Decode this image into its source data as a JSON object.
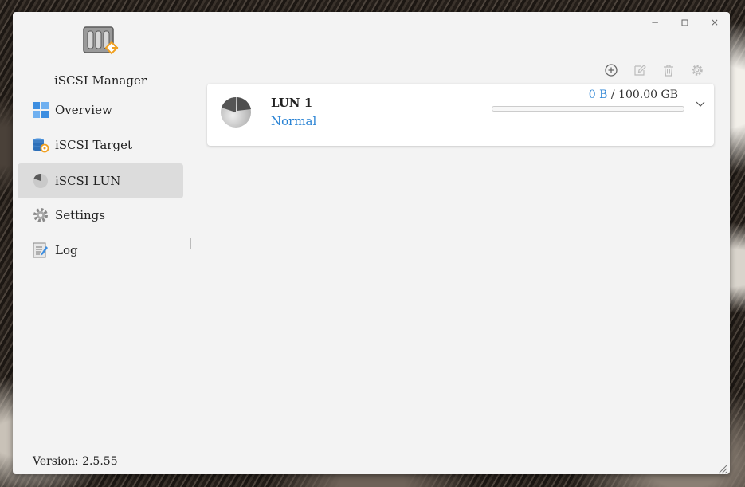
{
  "app": {
    "title": "iSCSI Manager",
    "version_label": "Version: 2.5.55",
    "accent_color": "#2a83d4"
  },
  "window_controls": {
    "minimize": "−",
    "maximize": "◻",
    "close": "×"
  },
  "sidebar": {
    "items": [
      {
        "label": "Overview",
        "icon": "overview-icon",
        "active": false
      },
      {
        "label": "iSCSI Target",
        "icon": "target-icon",
        "active": false
      },
      {
        "label": "iSCSI LUN",
        "icon": "lun-icon",
        "active": true
      },
      {
        "label": "Settings",
        "icon": "gear-icon",
        "active": false
      },
      {
        "label": "Log",
        "icon": "log-icon",
        "active": false
      }
    ]
  },
  "toolbar": {
    "icons": [
      "add-icon",
      "edit-icon",
      "delete-icon",
      "settings-icon"
    ]
  },
  "luns": [
    {
      "name": "LUN 1",
      "status": "Normal",
      "used": "0 B",
      "separator": " / ",
      "total": "100.00 GB",
      "usage_fraction": 0
    }
  ]
}
